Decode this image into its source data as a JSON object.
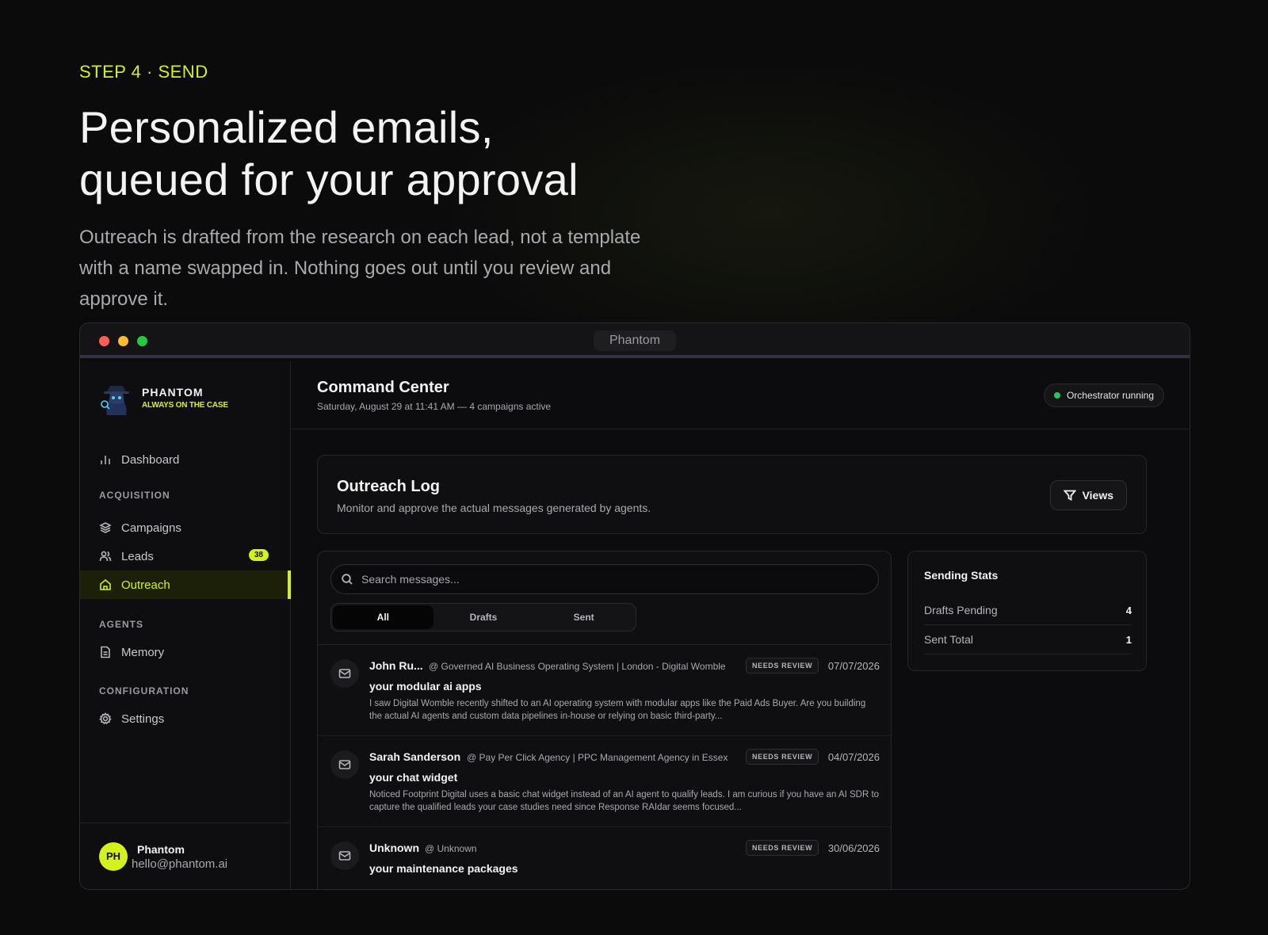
{
  "hero": {
    "eyebrow": "STEP 4 · SEND",
    "headline_line1": "Personalized emails,",
    "headline_line2": "queued for your approval",
    "subtext": "Outreach is drafted from the research on each lead, not a template with a name swapped in. Nothing goes out until you review and approve it."
  },
  "window": {
    "title": "Phantom"
  },
  "brand": {
    "name": "PHANTOM",
    "tagline": "ALWAYS ON THE CASE",
    "logo_icon": "phantom-detective-icon"
  },
  "sidebar": {
    "dashboard": {
      "label": "Dashboard",
      "icon": "bar-chart-icon"
    },
    "sections": {
      "acquisition": "ACQUISITION",
      "agents": "AGENTS",
      "configuration": "CONFIGURATION"
    },
    "campaigns": {
      "label": "Campaigns",
      "icon": "layers-icon"
    },
    "leads": {
      "label": "Leads",
      "icon": "users-icon",
      "badge": "38"
    },
    "outreach": {
      "label": "Outreach",
      "icon": "home-icon",
      "active": true
    },
    "memory": {
      "label": "Memory",
      "icon": "document-icon"
    },
    "settings": {
      "label": "Settings",
      "icon": "gear-icon"
    }
  },
  "user": {
    "initials": "PH",
    "name": "Phantom",
    "email": "hello@phantom.ai"
  },
  "header": {
    "title": "Command Center",
    "subtitle": "Saturday, August 29 at 11:41 AM — 4 campaigns active",
    "status": "Orchestrator running",
    "status_color": "#22c55e"
  },
  "outreach": {
    "title": "Outreach Log",
    "subtitle": "Monitor and approve the actual messages generated by agents.",
    "views_label": "Views"
  },
  "search": {
    "placeholder": "Search messages..."
  },
  "tabs": [
    "All",
    "Drafts",
    "Sent"
  ],
  "messages": [
    {
      "name": "John Ru...",
      "company": "@ Governed AI Business Operating System | London - Digital Womble",
      "badge": "NEEDS REVIEW",
      "date": "07/07/2026",
      "subject": "your modular ai apps",
      "preview": "I saw Digital Womble recently shifted to an AI operating system with modular apps like the Paid Ads Buyer. Are you building the actual AI agents and custom data pipelines in-house or relying on basic third-party..."
    },
    {
      "name": "Sarah Sanderson",
      "company": "@ Pay Per Click Agency | PPC Management Agency in Essex",
      "badge": "NEEDS REVIEW",
      "date": "04/07/2026",
      "subject": "your chat widget",
      "preview": "Noticed Footprint Digital uses a basic chat widget instead of an AI agent to qualify leads. I am curious if you have an AI SDR to capture the qualified leads your case studies need since Response RAIdar seems focused..."
    },
    {
      "name": "Unknown",
      "company": "@ Unknown",
      "badge": "NEEDS REVIEW",
      "date": "30/06/2026",
      "subject": "your maintenance packages",
      "preview": ""
    }
  ],
  "stats": {
    "title": "Sending Stats",
    "rows": [
      {
        "label": "Drafts Pending",
        "value": "4"
      },
      {
        "label": "Sent Total",
        "value": "1"
      }
    ]
  },
  "colors": {
    "accent": "#d4f21a",
    "background": "#0b0b0c"
  }
}
